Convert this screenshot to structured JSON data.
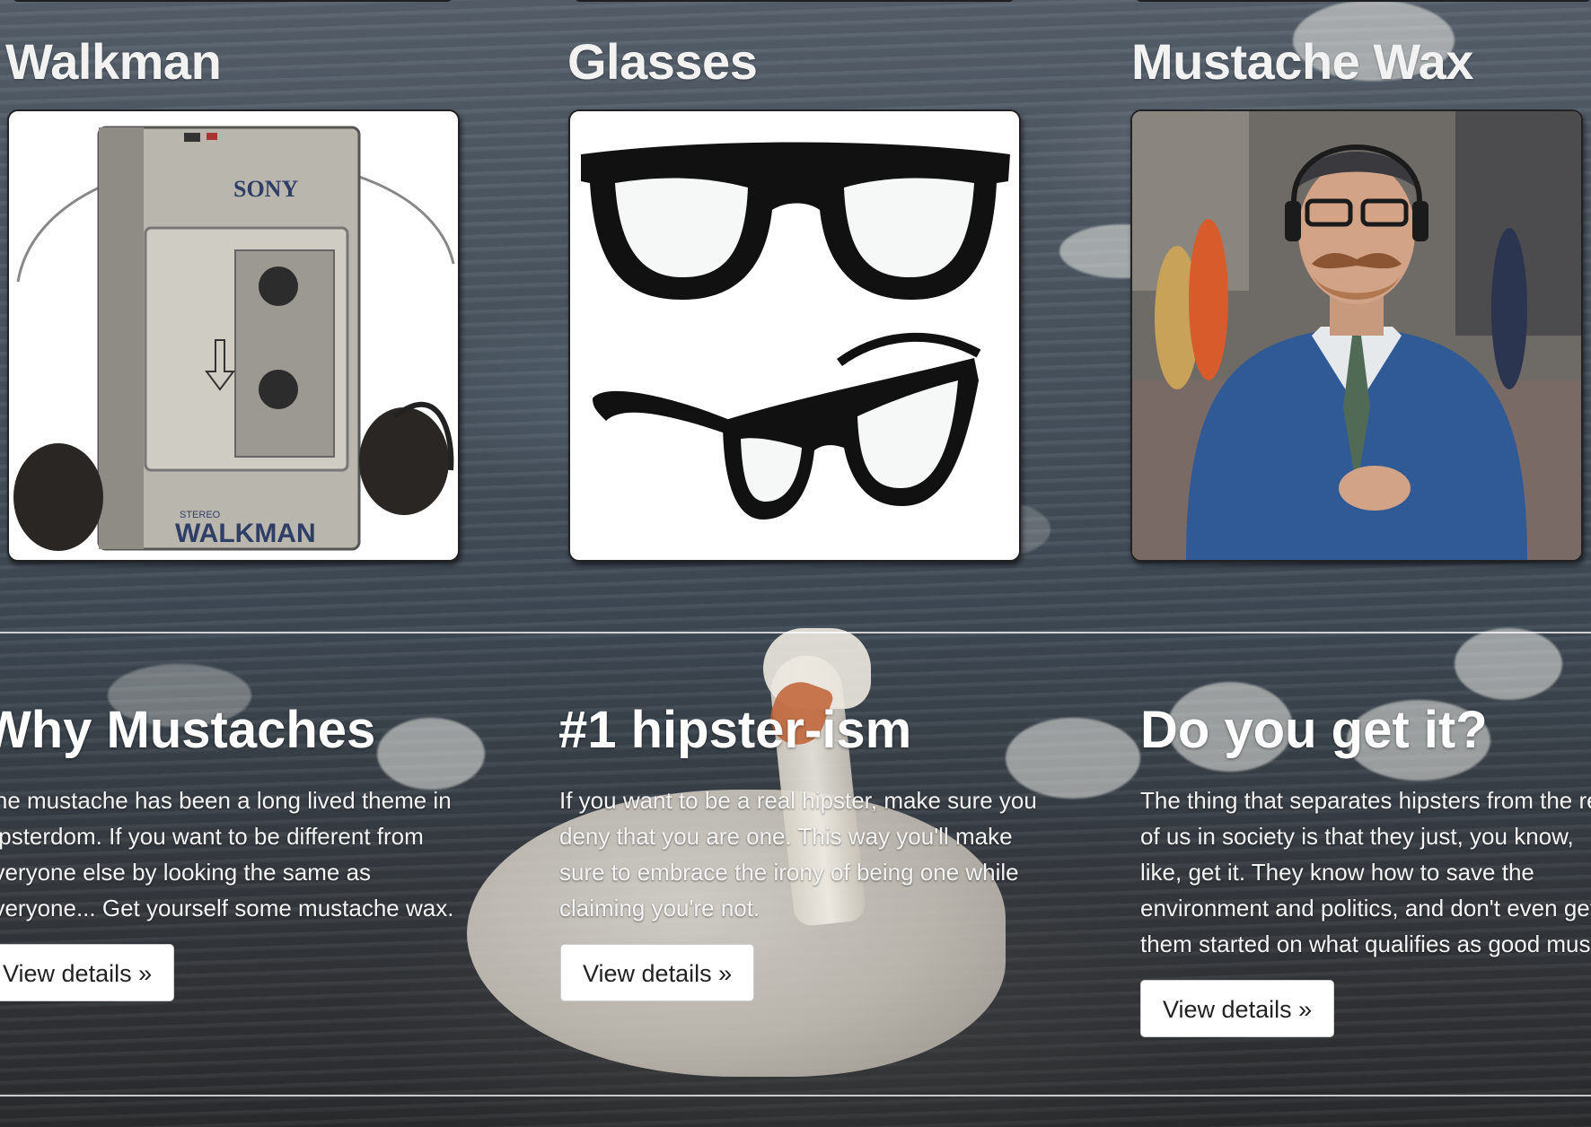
{
  "products": [
    {
      "title": "Walkman",
      "image": "walkman-image",
      "brand": "SONY",
      "model": "WALKMAN",
      "model_sub": "STEREO"
    },
    {
      "title": "Glasses",
      "image": "glasses-image"
    },
    {
      "title": "Mustache Wax",
      "image": "mustache-man-image"
    }
  ],
  "features": [
    {
      "title": "Why Mustaches",
      "lines": [
        "The mustache has been a long lived theme in",
        "hipsterdom. If you want to be different from",
        "everyone else by looking the same as",
        "everyone... Get yourself some mustache wax."
      ],
      "button": "View details »"
    },
    {
      "title": "#1 hipster-ism",
      "lines": [
        "If you want to be a real hipster, make sure you",
        "deny that you are one. This way you'll make",
        "sure to embrace the irony of being one while",
        "claiming you're not."
      ],
      "button": "View details »"
    },
    {
      "title": "Do you get it?",
      "lines": [
        "The thing that separates hipsters from the rest",
        "of us in society is that they just, you know,",
        "like, get it. They know how to save the",
        "environment and politics, and don't even get",
        "them started on what qualifies as good music."
      ],
      "button": "View details »"
    }
  ]
}
